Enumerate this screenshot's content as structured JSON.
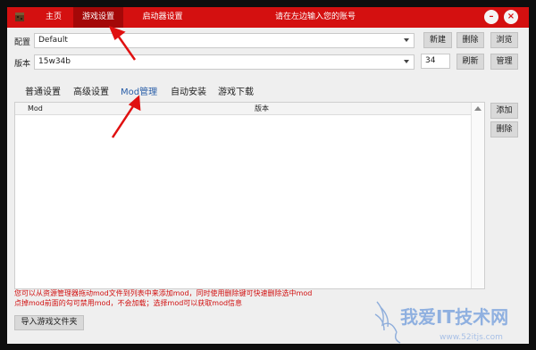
{
  "window": {
    "nav": {
      "home": "主页",
      "game_settings": "游戏设置",
      "launcher_settings": "启动器设置"
    },
    "hint": "请在左边输入您的账号",
    "min_icon": "minimize-icon",
    "close_icon": "close-icon"
  },
  "config": {
    "label": "配置",
    "value": "Default",
    "buttons": {
      "new": "新建",
      "delete": "删除",
      "browse": "浏览"
    }
  },
  "version": {
    "label": "版本",
    "value": "15w34b",
    "number": "34",
    "buttons": {
      "refresh": "刷新",
      "manage": "管理"
    }
  },
  "tabs": [
    "普通设置",
    "高级设置",
    "Mod管理",
    "自动安装",
    "游戏下载"
  ],
  "active_tab": "Mod管理",
  "mod_table": {
    "columns": [
      "Mod",
      "版本"
    ],
    "rows": []
  },
  "mod_actions": {
    "add": "添加",
    "delete": "删除"
  },
  "note": {
    "line1": "您可以从资源管理器拖动mod文件到列表中来添加mod，同时使用删除键可快速删除选中mod",
    "line2": "点掉mod前面的勾可禁用mod，不会加载；选择mod可以获取mod信息"
  },
  "import_button": "导入游戏文件夹",
  "watermark": {
    "text": "我爱IT技术网",
    "sub": "www.52itjs.com"
  },
  "colors": {
    "titlebar": "#d41010",
    "nav_active": "#a40808",
    "active_tab": "#2a5fa8",
    "note": "#d11010",
    "annotation_arrow": "#e01010"
  }
}
